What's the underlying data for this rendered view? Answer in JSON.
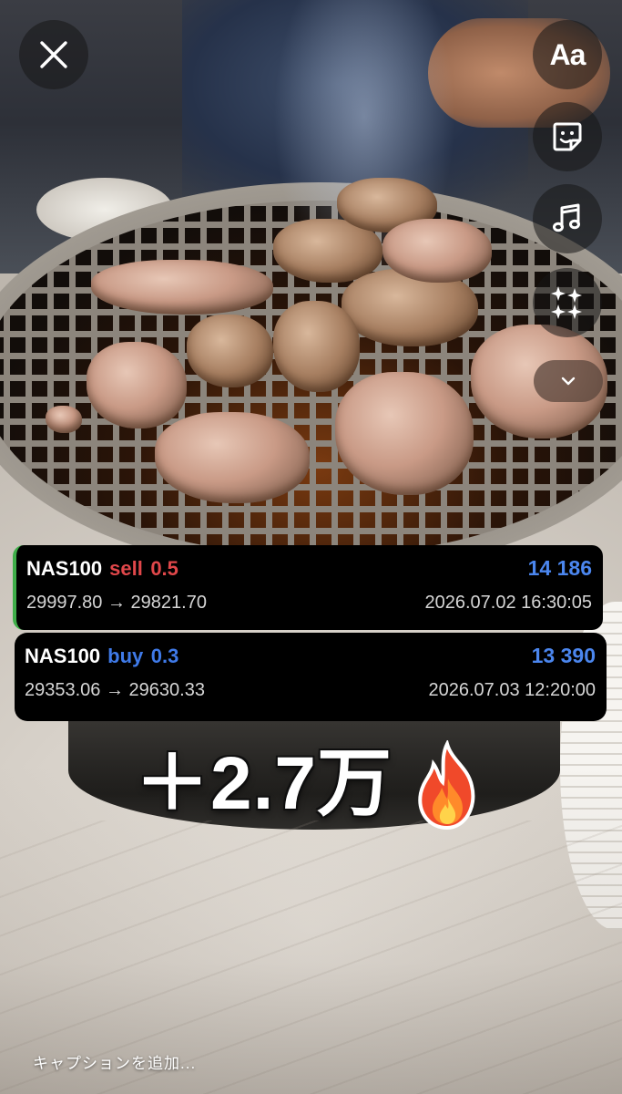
{
  "controls": {
    "close_icon": "close-icon",
    "text_tool_label": "Aa",
    "sticker_icon": "sticker-icon",
    "music_icon": "music-note-icon",
    "effects_icon": "sparkles-icon",
    "expand_icon": "chevron-down-icon"
  },
  "trades": [
    {
      "symbol": "NAS100",
      "side": "sell",
      "volume": "0.5",
      "profit": "14 186",
      "prices": "29997.80 → 29821.70",
      "time": "2026.07.02 16:30:05",
      "accent": "#3fae49",
      "side_color": "#e0474a"
    },
    {
      "symbol": "NAS100",
      "side": "buy",
      "volume": "0.3",
      "profit": "13 390",
      "prices": "29353.06 → 29630.33",
      "time": "2026.07.03 12:20:00",
      "side_color": "#3f7ae8"
    }
  ],
  "sticker": {
    "text": "＋2.7万",
    "emoji_icon": "fire-icon"
  },
  "caption": {
    "placeholder": "キャプションを追加..."
  },
  "colors": {
    "profit": "#4b86ee",
    "card_bg": "#000000"
  }
}
